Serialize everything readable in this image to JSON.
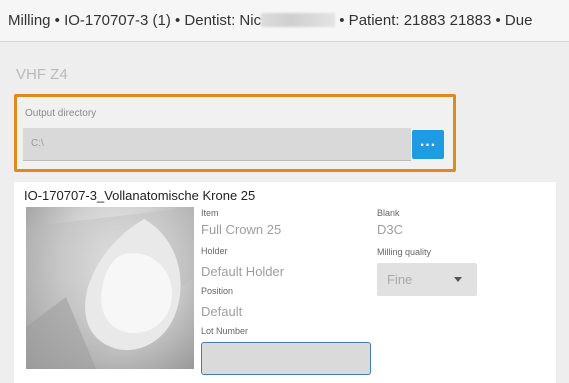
{
  "header": {
    "breadcrumb_start": "Milling • IO-170707-3 (1) • Dentist: Nic",
    "breadcrumb_end": "• Patient: 21883 21883 • Due"
  },
  "device": {
    "name": "VHF Z4"
  },
  "output_directory": {
    "label": "Output directory",
    "value": "C:\\",
    "browse_label": "..."
  },
  "job": {
    "title": "IO-170707-3_Vollanatomische Krone 25",
    "item": {
      "label": "Item",
      "value": "Full Crown 25"
    },
    "holder": {
      "label": "Holder",
      "value": "Default Holder"
    },
    "position": {
      "label": "Position",
      "value": "Default"
    },
    "lot_number": {
      "label": "Lot Number",
      "value": ""
    },
    "blank": {
      "label": "Blank",
      "value": "D3C"
    },
    "milling_quality": {
      "label": "Milling quality",
      "value": "Fine"
    }
  },
  "colors": {
    "accent_orange": "#e08a1c",
    "browse_blue": "#1e9be3"
  }
}
